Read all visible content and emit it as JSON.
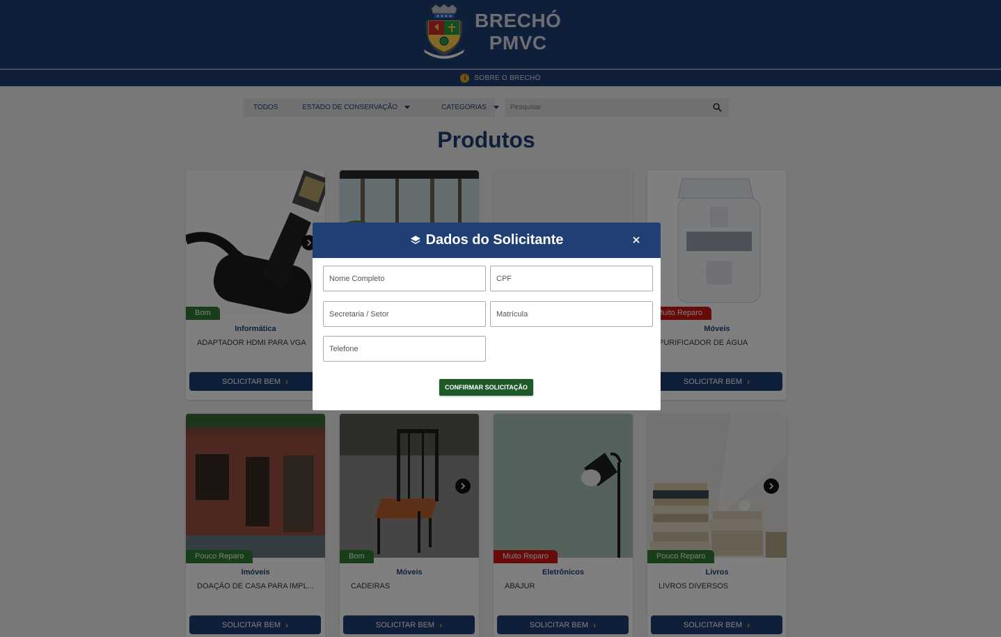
{
  "brand": {
    "line1": "BRECHÓ",
    "line2": "PMVC",
    "crest_icon": "city-crest-icon"
  },
  "subbar": {
    "about_label": "SOBRE O BRECHÓ",
    "info_icon": "info-icon"
  },
  "filters": {
    "all_label": "TODOS",
    "condition_label": "ESTADO DE CONSERVAÇÃO",
    "categories_label": "CATEGORIAS"
  },
  "search": {
    "placeholder": "Pesquisar"
  },
  "page_title": "Produtos",
  "colors": {
    "primary": "#1f3f75",
    "accent": "#e8a21c",
    "good": "#2e7d32",
    "bad": "#cc1414",
    "confirm": "#1d5a27"
  },
  "products_row1": [
    {
      "condition": "Bom",
      "category": "Informática",
      "name": "ADAPTADOR HDMI PARA VGA",
      "button": "SOLICITAR BEM"
    },
    {
      "condition": "",
      "category": "",
      "name": "",
      "button": ""
    },
    {
      "condition": "",
      "category": "",
      "name": "",
      "button": ""
    },
    {
      "condition": "Muito Reparo",
      "category": "Móveis",
      "name": "PURIFICADOR DE ÁGUA",
      "button": "SOLICITAR BEM"
    }
  ],
  "products_row2": [
    {
      "condition": "Pouco Reparo",
      "category": "Imóveis",
      "name": "DOAÇÃO DE CASA PARA IMPL...",
      "button": "SOLICITAR BEM"
    },
    {
      "condition": "Bom",
      "category": "Móveis",
      "name": "CADEIRAS",
      "button": "SOLICITAR BEM"
    },
    {
      "condition": "Muito Reparo",
      "category": "Eletrônicos",
      "name": "ABAJUR",
      "button": "SOLICITAR BEM"
    },
    {
      "condition": "Pouco Reparo",
      "category": "Livros",
      "name": "LIVROS DIVERSOS",
      "button": "SOLICITAR BEM"
    }
  ],
  "modal": {
    "title": "Dados do Solicitante",
    "fields": {
      "nome": "Nome Completo",
      "cpf": "CPF",
      "secretaria": "Secretaria / Setor",
      "matricula": "Matrícula",
      "telefone": "Telefone"
    },
    "confirm_label": "CONFIRMAR SOLICITAÇÃO"
  }
}
